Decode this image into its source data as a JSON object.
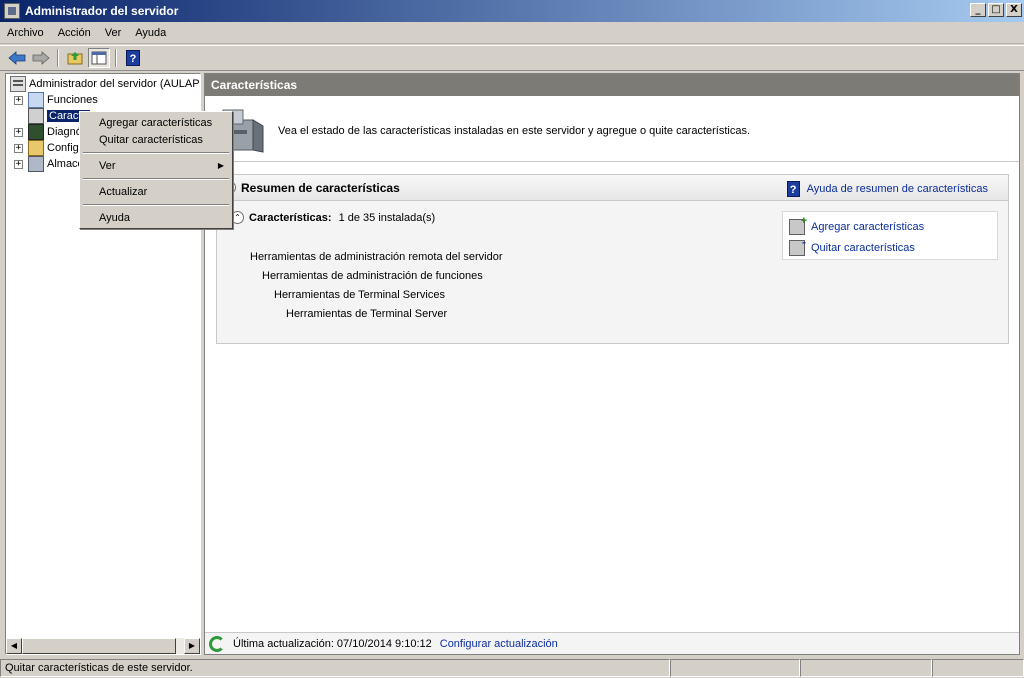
{
  "window": {
    "title": "Administrador del servidor",
    "buttons": {
      "minimize": "_",
      "maximize": "□",
      "close": "X"
    }
  },
  "menubar": {
    "items": [
      "Archivo",
      "Acción",
      "Ver",
      "Ayuda"
    ]
  },
  "toolbar": {
    "icons": [
      "back-arrow-icon",
      "forward-arrow-icon",
      "up-folder-icon",
      "show-hide-tree-icon",
      "help-icon"
    ]
  },
  "tree": {
    "root": "Administrador del servidor (AULAPC",
    "items": [
      {
        "label": "Funciones",
        "expander": "+",
        "icon": "roles-icon"
      },
      {
        "label": "Caracte",
        "expander": "",
        "icon": "features-icon",
        "selected": true
      },
      {
        "label": "Diagnó",
        "expander": "+",
        "icon": "diagnostics-icon"
      },
      {
        "label": "Configu",
        "expander": "+",
        "icon": "configuration-icon"
      },
      {
        "label": "Almace",
        "expander": "+",
        "icon": "storage-icon"
      }
    ]
  },
  "context_menu": {
    "items": [
      "Agregar características",
      "Quitar características",
      "Ver",
      "Actualizar",
      "Ayuda"
    ]
  },
  "main": {
    "header": "Características",
    "intro": "Vea el estado de las características instaladas en este servidor y agregue o quite características.",
    "summary": {
      "title": "Resumen de características",
      "help_link": "Ayuda de resumen de características",
      "section_title": "Características:",
      "section_count": "1 de 35 instalada(s)",
      "features": [
        "Herramientas de administración remota del servidor",
        "Herramientas de administración de funciones",
        "Herramientas de Terminal Services",
        "Herramientas de Terminal Server"
      ],
      "actions": [
        "Agregar características",
        "Quitar características"
      ]
    },
    "footer": {
      "last_update": "Última actualización: 07/10/2014 9:10:12",
      "configure_link": "Configurar actualización"
    }
  },
  "statusbar": {
    "text": "Quitar características de este servidor."
  },
  "colors": {
    "title_start": "#0a246a",
    "title_end": "#a6caf0",
    "link": "#0b2d9c",
    "selection": "#0a246a"
  }
}
